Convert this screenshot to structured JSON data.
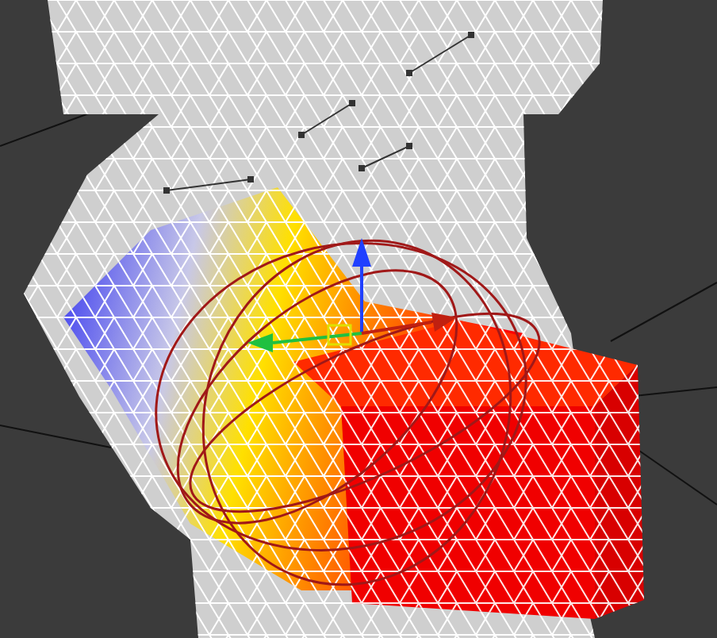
{
  "viewport": {
    "gizmo": {
      "kind": "rotate"
    }
  }
}
